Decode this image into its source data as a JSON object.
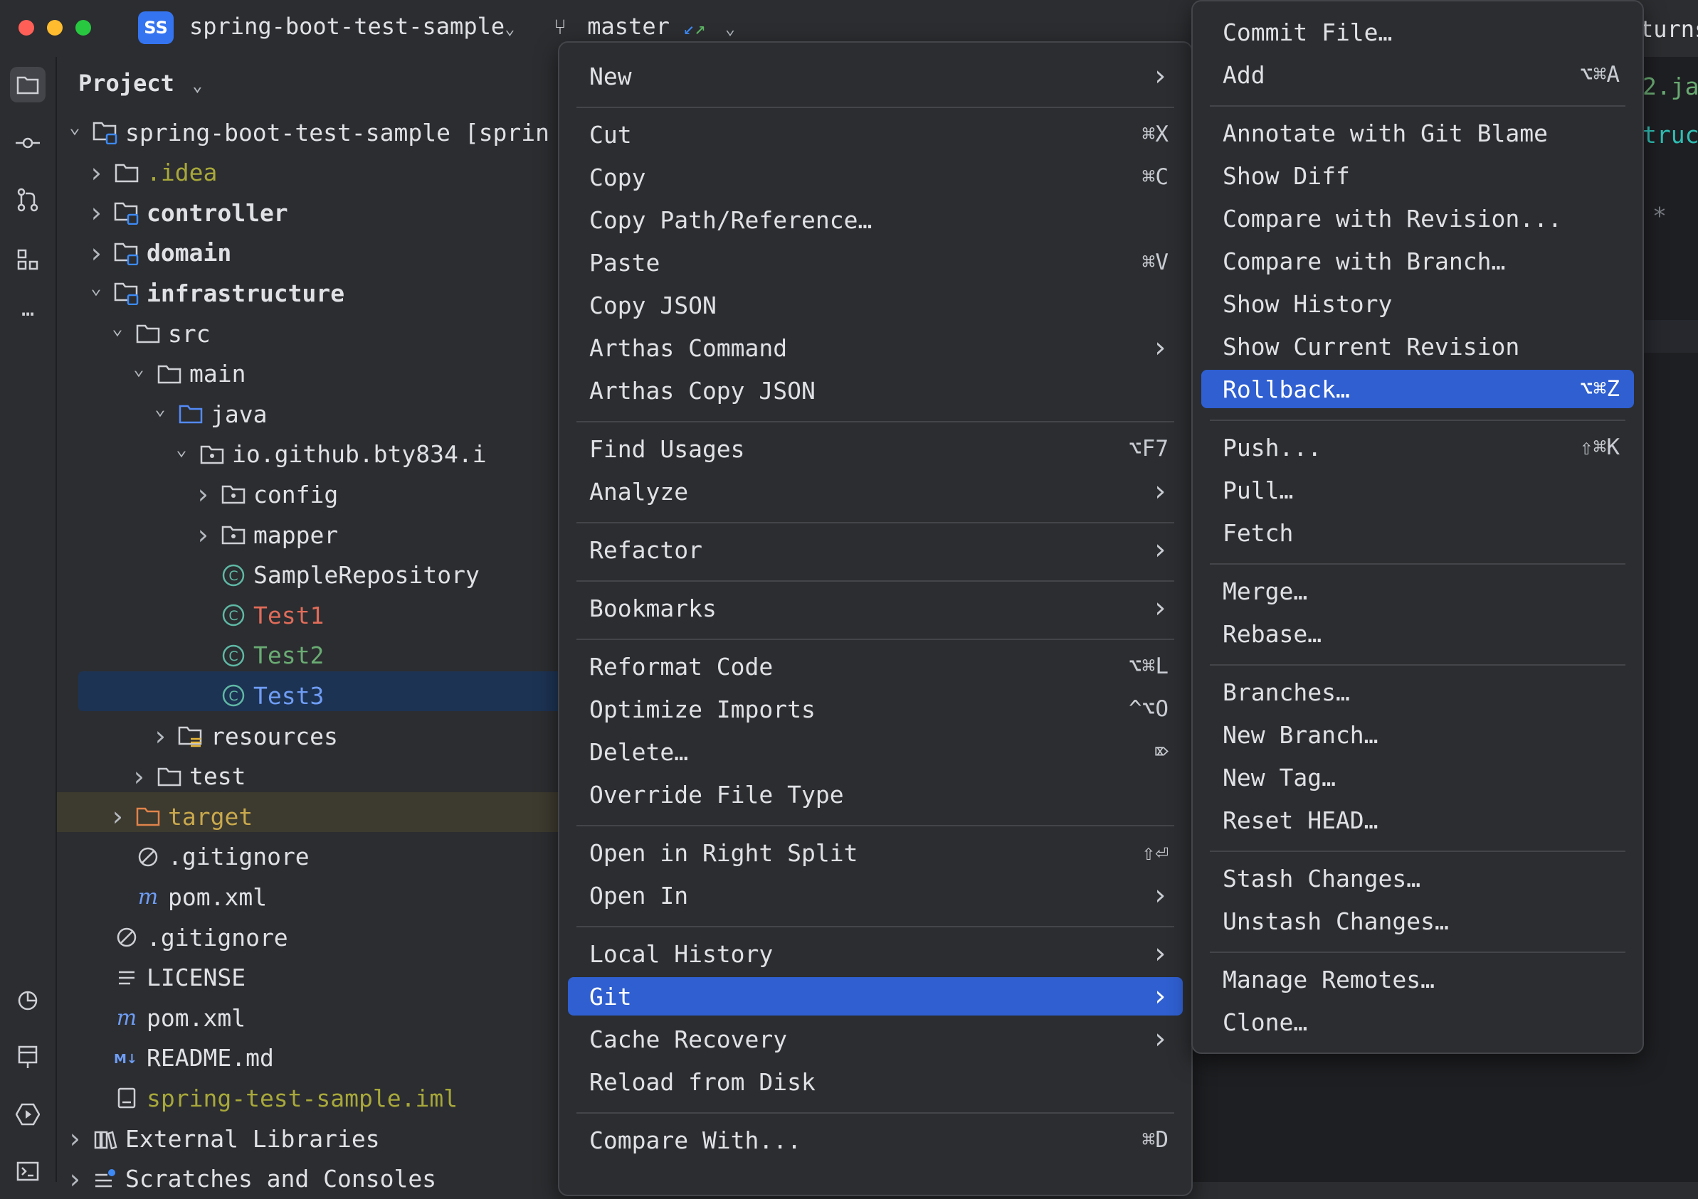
{
  "titlebar": {
    "project_initials": "SS",
    "project_name": "spring-boot-test-sample",
    "branch": "master",
    "right_fragment": "turns"
  },
  "project_panel": {
    "title": "Project",
    "tree": [
      {
        "label": "spring-boot-test-sample [sprin",
        "depth": 0,
        "icon": "module-folder-icon",
        "chevron": "down",
        "color": "#dfe1e5",
        "bold": false
      },
      {
        "label": ".idea",
        "depth": 1,
        "icon": "folder-icon",
        "chevron": "right",
        "color": "#a8a83b",
        "bold": false
      },
      {
        "label": "controller",
        "depth": 1,
        "icon": "module-folder-icon",
        "chevron": "right",
        "color": "#dfe1e5",
        "bold": true
      },
      {
        "label": "domain",
        "depth": 1,
        "icon": "module-folder-icon",
        "chevron": "right",
        "color": "#dfe1e5",
        "bold": true
      },
      {
        "label": "infrastructure",
        "depth": 1,
        "icon": "module-folder-icon",
        "chevron": "down",
        "color": "#dfe1e5",
        "bold": true
      },
      {
        "label": "src",
        "depth": 2,
        "icon": "folder-icon",
        "chevron": "down",
        "color": "#dfe1e5",
        "bold": false
      },
      {
        "label": "main",
        "depth": 3,
        "icon": "folder-icon",
        "chevron": "down",
        "color": "#dfe1e5",
        "bold": false
      },
      {
        "label": "java",
        "depth": 4,
        "icon": "source-folder-icon",
        "chevron": "down",
        "color": "#dfe1e5",
        "bold": false
      },
      {
        "label": "io.github.bty834.i",
        "depth": 5,
        "icon": "package-icon",
        "chevron": "down",
        "color": "#dfe1e5",
        "bold": false
      },
      {
        "label": "config",
        "depth": 6,
        "icon": "package-icon",
        "chevron": "right",
        "color": "#dfe1e5",
        "bold": false
      },
      {
        "label": "mapper",
        "depth": 6,
        "icon": "package-icon",
        "chevron": "right",
        "color": "#dfe1e5",
        "bold": false
      },
      {
        "label": "SampleRepository",
        "depth": 6,
        "icon": "class-icon",
        "chevron": "none",
        "color": "#dfe1e5",
        "bold": false
      },
      {
        "label": "Test1",
        "depth": 6,
        "icon": "class-icon",
        "chevron": "none",
        "color": "#e06c5a",
        "bold": false
      },
      {
        "label": "Test2",
        "depth": 6,
        "icon": "class-icon",
        "chevron": "none",
        "color": "#6aab73",
        "bold": false
      },
      {
        "label": "Test3",
        "depth": 6,
        "icon": "class-icon",
        "chevron": "none",
        "color": "#6f9df5",
        "bold": false
      },
      {
        "label": "resources",
        "depth": 4,
        "icon": "resources-folder-icon",
        "chevron": "right",
        "color": "#dfe1e5",
        "bold": false
      },
      {
        "label": "test",
        "depth": 3,
        "icon": "folder-icon",
        "chevron": "right",
        "color": "#dfe1e5",
        "bold": false
      },
      {
        "label": "target",
        "depth": 2,
        "icon": "excluded-folder-icon",
        "chevron": "right",
        "color": "#c9a94d",
        "bold": false
      },
      {
        "label": ".gitignore",
        "depth": 2,
        "icon": "ignore-icon",
        "chevron": "none",
        "color": "#dfe1e5",
        "bold": false
      },
      {
        "label": "pom.xml",
        "depth": 2,
        "icon": "maven-icon",
        "chevron": "none",
        "color": "#dfe1e5",
        "bold": false
      },
      {
        "label": ".gitignore",
        "depth": 1,
        "icon": "ignore-icon",
        "chevron": "none",
        "color": "#dfe1e5",
        "bold": false
      },
      {
        "label": "LICENSE",
        "depth": 1,
        "icon": "text-file-icon",
        "chevron": "none",
        "color": "#dfe1e5",
        "bold": false
      },
      {
        "label": "pom.xml",
        "depth": 1,
        "icon": "maven-icon",
        "chevron": "none",
        "color": "#dfe1e5",
        "bold": false
      },
      {
        "label": "README.md",
        "depth": 1,
        "icon": "markdown-icon",
        "chevron": "none",
        "color": "#dfe1e5",
        "bold": false
      },
      {
        "label": "spring-test-sample.iml",
        "depth": 1,
        "icon": "iml-icon",
        "chevron": "none",
        "color": "#a8a83b",
        "bold": false
      },
      {
        "label": "External Libraries",
        "depth": 0,
        "icon": "library-icon",
        "chevron": "right",
        "color": "#dfe1e5",
        "bold": false
      },
      {
        "label": "Scratches and Consoles",
        "depth": 0,
        "icon": "scratches-icon",
        "chevron": "right",
        "color": "#dfe1e5",
        "bold": false
      }
    ]
  },
  "editor": {
    "fragments": [
      "2.ja",
      "truc",
      "*"
    ]
  },
  "context_menu": {
    "items": [
      {
        "label": "New",
        "submenu": true
      },
      {
        "sep": true
      },
      {
        "label": "Cut",
        "shortcut": "⌘X"
      },
      {
        "label": "Copy",
        "shortcut": "⌘C"
      },
      {
        "label": "Copy Path/Reference…"
      },
      {
        "label": "Paste",
        "shortcut": "⌘V"
      },
      {
        "label": "Copy JSON"
      },
      {
        "label": "Arthas Command",
        "submenu": true
      },
      {
        "label": "Arthas Copy JSON"
      },
      {
        "sep": true
      },
      {
        "label": "Find Usages",
        "shortcut": "⌥F7"
      },
      {
        "label": "Analyze",
        "submenu": true
      },
      {
        "sep": true
      },
      {
        "label": "Refactor",
        "submenu": true
      },
      {
        "sep": true
      },
      {
        "label": "Bookmarks",
        "submenu": true
      },
      {
        "sep": true
      },
      {
        "label": "Reformat Code",
        "shortcut": "⌥⌘L"
      },
      {
        "label": "Optimize Imports",
        "shortcut": "^⌥O"
      },
      {
        "label": "Delete…",
        "shortcut": "⌦"
      },
      {
        "label": "Override File Type"
      },
      {
        "sep": true
      },
      {
        "label": "Open in Right Split",
        "shortcut": "⇧⏎"
      },
      {
        "label": "Open In",
        "submenu": true
      },
      {
        "sep": true
      },
      {
        "label": "Local History",
        "submenu": true
      },
      {
        "label": "Git",
        "submenu": true,
        "highlighted": true
      },
      {
        "label": "Cache Recovery",
        "submenu": true
      },
      {
        "label": "Reload from Disk"
      },
      {
        "sep": true
      },
      {
        "label": "Compare With...",
        "shortcut": "⌘D"
      }
    ]
  },
  "git_submenu": {
    "items": [
      {
        "label": "Commit File…"
      },
      {
        "label": "Add",
        "shortcut": "⌥⌘A"
      },
      {
        "sep": true
      },
      {
        "label": "Annotate with Git Blame"
      },
      {
        "label": "Show Diff"
      },
      {
        "label": "Compare with Revision..."
      },
      {
        "label": "Compare with Branch…"
      },
      {
        "label": "Show History"
      },
      {
        "label": "Show Current Revision"
      },
      {
        "label": "Rollback…",
        "shortcut": "⌥⌘Z",
        "highlighted": true
      },
      {
        "sep": true
      },
      {
        "label": "Push...",
        "shortcut": "⇧⌘K"
      },
      {
        "label": "Pull…"
      },
      {
        "label": "Fetch"
      },
      {
        "sep": true
      },
      {
        "label": "Merge…"
      },
      {
        "label": "Rebase…"
      },
      {
        "sep": true
      },
      {
        "label": "Branches…"
      },
      {
        "label": "New Branch…"
      },
      {
        "label": "New Tag…"
      },
      {
        "label": "Reset HEAD…"
      },
      {
        "sep": true
      },
      {
        "label": "Stash Changes…"
      },
      {
        "label": "Unstash Changes…"
      },
      {
        "sep": true
      },
      {
        "label": "Manage Remotes…"
      },
      {
        "label": "Clone…"
      }
    ]
  }
}
